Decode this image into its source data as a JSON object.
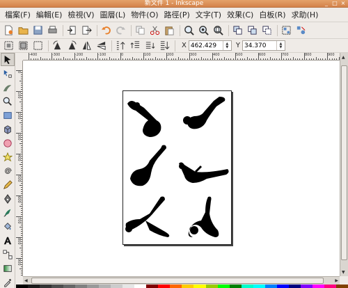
{
  "window": {
    "title": "新文件 1 - Inkscape"
  },
  "menu": [
    {
      "label": "檔案(F)"
    },
    {
      "label": "編輯(E)"
    },
    {
      "label": "檢視(V)"
    },
    {
      "label": "圖層(L)"
    },
    {
      "label": "物件(O)"
    },
    {
      "label": "路徑(P)"
    },
    {
      "label": "文字(T)"
    },
    {
      "label": "效果(C)"
    },
    {
      "label": "白板(R)"
    },
    {
      "label": "求助(H)"
    }
  ],
  "toolbar2": {
    "x_label": "X",
    "x_value": "462.429",
    "y_label": "Y",
    "y_value": "34.370"
  },
  "ruler": {
    "h_labels": [
      "-400",
      "-300",
      "-200",
      "-100",
      "0",
      "100",
      "200",
      "300",
      "400",
      "500",
      "600",
      "700",
      "800",
      "900"
    ],
    "v_labels": [
      "0",
      "100",
      "200",
      "300",
      "400",
      "500",
      "600",
      "700",
      "800",
      "900",
      "1000"
    ]
  },
  "colors": {
    "title_bar": "#d98f56",
    "palette": [
      "#000000",
      "#1a1a1a",
      "#333333",
      "#4d4d4d",
      "#666666",
      "#808080",
      "#999999",
      "#b3b3b3",
      "#cccccc",
      "#e6e6e6",
      "#ffffff",
      "#800000",
      "#ff0000",
      "#ff6600",
      "#ffcc00",
      "#ffff00",
      "#99cc00",
      "#00ff00",
      "#008000",
      "#00ffcc",
      "#00ffff",
      "#0080ff",
      "#0000ff",
      "#000080",
      "#8000ff",
      "#ff00ff",
      "#ff0080",
      "#804000"
    ]
  },
  "document": {
    "figures": [
      "dancer-silhouette",
      "dancer-silhouette",
      "dancer-silhouette",
      "dancer-silhouette",
      "dancer-silhouette",
      "dancer-silhouette"
    ]
  }
}
